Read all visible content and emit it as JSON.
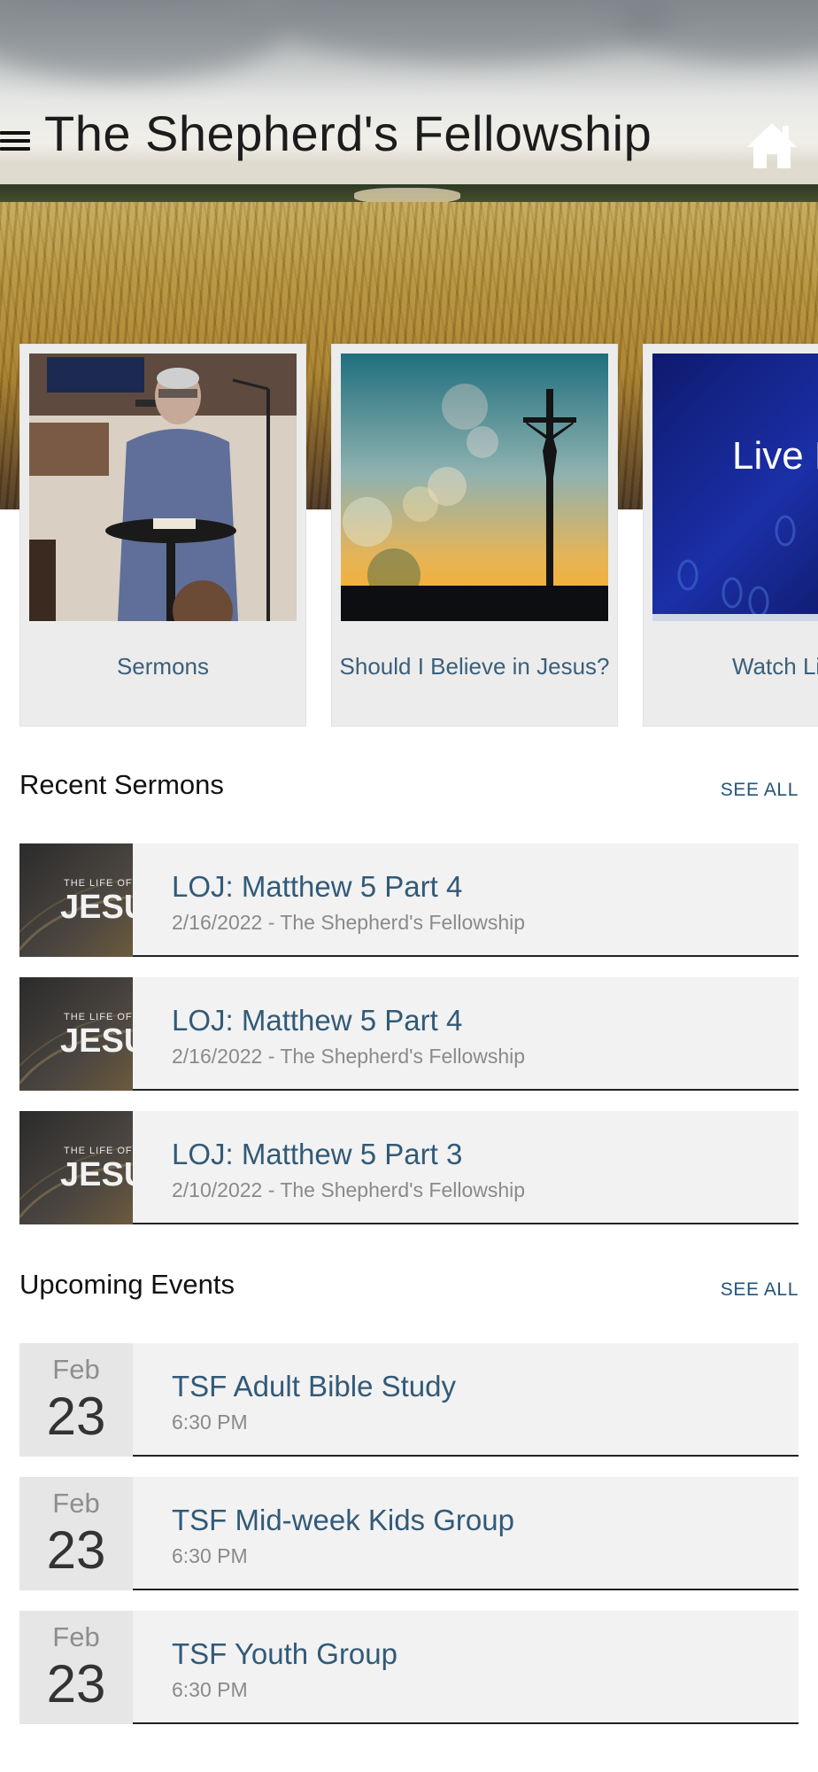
{
  "header": {
    "title": "The Shepherd's Fellowship"
  },
  "feature_cards": [
    {
      "label": "Sermons"
    },
    {
      "label": "Should I Believe in Jesus?"
    },
    {
      "label": "Watch Li",
      "thumb_text": "Live Fee"
    }
  ],
  "recent_sermons": {
    "title": "Recent Sermons",
    "see_all": "SEE ALL",
    "thumb_text": "THE LIFE OF",
    "thumb_text_big": "JESUS",
    "items": [
      {
        "title": "LOJ: Matthew 5 Part 4",
        "subtitle": "2/16/2022 - The Shepherd's Fellowship"
      },
      {
        "title": "LOJ: Matthew 5 Part 4",
        "subtitle": "2/16/2022 - The Shepherd's Fellowship"
      },
      {
        "title": "LOJ: Matthew 5 Part 3",
        "subtitle": "2/10/2022 - The Shepherd's Fellowship"
      }
    ]
  },
  "upcoming_events": {
    "title": "Upcoming Events",
    "see_all": "SEE ALL",
    "items": [
      {
        "month": "Feb",
        "day": "23",
        "title": "TSF Adult Bible Study",
        "time": "6:30 PM"
      },
      {
        "month": "Feb",
        "day": "23",
        "title": "TSF Mid-week Kids Group",
        "time": "6:30 PM"
      },
      {
        "month": "Feb",
        "day": "23",
        "title": "TSF Youth Group",
        "time": "6:30 PM"
      }
    ]
  },
  "colors": {
    "link_blue": "#325a78",
    "see_all_blue": "#245478",
    "row_bg": "#f2f2f2",
    "card_bg": "#ececec"
  }
}
